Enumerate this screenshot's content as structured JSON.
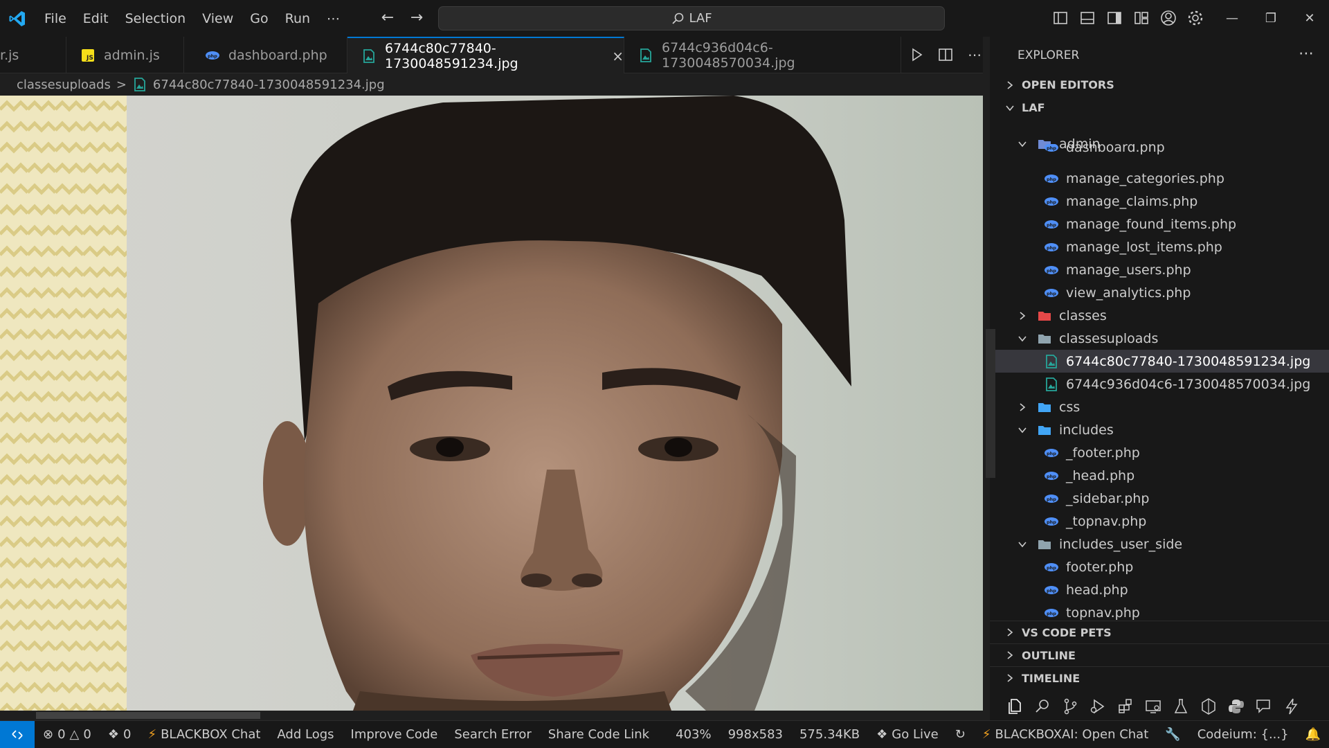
{
  "menu": [
    "File",
    "Edit",
    "Selection",
    "View",
    "Go",
    "Run",
    "⋯"
  ],
  "command_center": {
    "text": "LAF"
  },
  "tabs": [
    {
      "label": "r.js",
      "icon": "js-icon",
      "active": false
    },
    {
      "label": "admin.js",
      "icon": "js-icon",
      "active": false
    },
    {
      "label": "dashboard.php",
      "icon": "php-icon",
      "active": false
    },
    {
      "label": "6744c80c77840-1730048591234.jpg",
      "icon": "image-icon",
      "active": true,
      "close": "×"
    },
    {
      "label": "6744c936d04c6-1730048570034.jpg",
      "icon": "image-icon",
      "active": false
    }
  ],
  "breadcrumb": {
    "folder": "classesuploads",
    "separator": ">",
    "file": "6744c80c77840-1730048591234.jpg"
  },
  "explorer": {
    "title": "EXPLORER",
    "more": "⋯",
    "sections": {
      "open_editors": "OPEN EDITORS",
      "root": "LAF",
      "vs_code_pets": "VS CODE PETS",
      "outline": "OUTLINE",
      "timeline": "TIMELINE"
    },
    "tree": [
      {
        "label": "admin",
        "type": "folder",
        "expanded": true,
        "depth": 1,
        "icon_color": "#6f8bd6"
      },
      {
        "label": "dashboard.php",
        "type": "php",
        "depth": 2,
        "partial": true
      },
      {
        "label": "manage_categories.php",
        "type": "php",
        "depth": 2
      },
      {
        "label": "manage_claims.php",
        "type": "php",
        "depth": 2
      },
      {
        "label": "manage_found_items.php",
        "type": "php",
        "depth": 2
      },
      {
        "label": "manage_lost_items.php",
        "type": "php",
        "depth": 2
      },
      {
        "label": "manage_users.php",
        "type": "php",
        "depth": 2
      },
      {
        "label": "view_analytics.php",
        "type": "php",
        "depth": 2
      },
      {
        "label": "classes",
        "type": "folder",
        "expanded": false,
        "depth": 1,
        "icon_color": "#e54848"
      },
      {
        "label": "classesuploads",
        "type": "folder",
        "expanded": true,
        "depth": 1,
        "icon_color": "#90a4ae"
      },
      {
        "label": "6744c80c77840-1730048591234.jpg",
        "type": "image",
        "depth": 2,
        "selected": true
      },
      {
        "label": "6744c936d04c6-1730048570034.jpg",
        "type": "image",
        "depth": 2
      },
      {
        "label": "css",
        "type": "folder",
        "expanded": false,
        "depth": 1,
        "icon_color": "#42a5f5"
      },
      {
        "label": "includes",
        "type": "folder",
        "expanded": true,
        "depth": 1,
        "icon_color": "#42a5f5"
      },
      {
        "label": "_footer.php",
        "type": "php",
        "depth": 2
      },
      {
        "label": "_head.php",
        "type": "php",
        "depth": 2
      },
      {
        "label": "_sidebar.php",
        "type": "php",
        "depth": 2
      },
      {
        "label": "_topnav.php",
        "type": "php",
        "depth": 2
      },
      {
        "label": "includes_user_side",
        "type": "folder",
        "expanded": true,
        "depth": 1,
        "icon_color": "#90a4ae"
      },
      {
        "label": "footer.php",
        "type": "php",
        "depth": 2
      },
      {
        "label": "head.php",
        "type": "php",
        "depth": 2
      },
      {
        "label": "topnav.php",
        "type": "php",
        "depth": 2
      }
    ]
  },
  "statusbar": {
    "errors": "0",
    "warnings": "0",
    "ports": "0",
    "blackbox_chat": "BLACKBOX Chat",
    "add_logs": "Add Logs",
    "improve_code": "Improve Code",
    "search_error": "Search Error",
    "share_code_link": "Share Code Link",
    "zoom": "403%",
    "dimensions": "998x583",
    "file_size": "575.34KB",
    "go_live": "Go Live",
    "blackboxai": "BLACKBOXAI: Open Chat",
    "codeium": "Codeium: {...}"
  },
  "colors": {
    "accent": "#0078d4",
    "php_icon": "#4f8ff7",
    "image_icon": "#26a69a",
    "js_icon": "#f5de19"
  }
}
